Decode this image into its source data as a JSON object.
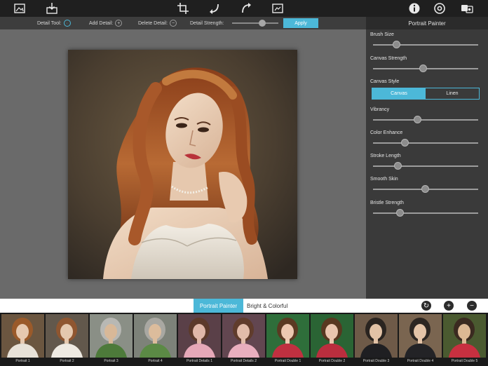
{
  "toolbar": {
    "left_icons": [
      "image-open-icon",
      "save-export-icon"
    ],
    "center_icons": [
      "crop-icon",
      "undo-icon",
      "redo-icon",
      "compare-icon"
    ],
    "right_icons": [
      "info-icon",
      "settings-icon",
      "share-icon"
    ]
  },
  "detail_bar": {
    "detail_tool_label": "Detail Tool:",
    "add_detail_label": "Add Detail:",
    "delete_detail_label": "Delete Detail:",
    "detail_strength_label": "Detail Strength:",
    "detail_strength_value": 0.65,
    "apply_label": "Apply"
  },
  "panel": {
    "title": "Portrait Painter",
    "sliders": [
      {
        "label": "Brush Size",
        "value": 0.22
      },
      {
        "label": "Canvas Strength",
        "value": 0.47
      },
      {
        "label": "Vibrancy",
        "value": 0.42
      },
      {
        "label": "Color Enhance",
        "value": 0.3
      },
      {
        "label": "Stroke Length",
        "value": 0.23
      },
      {
        "label": "Smooth Skin",
        "value": 0.49
      },
      {
        "label": "Bristle Strength",
        "value": 0.25
      }
    ],
    "canvas_style": {
      "label": "Canvas Style",
      "options": [
        "Canvas",
        "Linen"
      ],
      "selected": "Canvas"
    }
  },
  "preset_tabs": {
    "active": "Portrait Painter",
    "other": "Bright & Colorful"
  },
  "preset_icons": [
    "reset-icon",
    "add-icon",
    "remove-icon"
  ],
  "thumbnails": [
    {
      "label": "Portrait 1",
      "bg": "#6b5640",
      "hair": "#9a5a2a",
      "skin": "#e6c9b0",
      "dress": "#e8e2d8"
    },
    {
      "label": "Portrait 2",
      "bg": "#62584c",
      "hair": "#8f5630",
      "skin": "#e4c8ae",
      "dress": "#eeeae2"
    },
    {
      "label": "Portrait 3",
      "bg": "#8a8f86",
      "hair": "#b8b8b4",
      "skin": "#d8b898",
      "dress": "#4d7a3a"
    },
    {
      "label": "Portrait 4",
      "bg": "#7d8279",
      "hair": "#a9a8a2",
      "skin": "#dcbc9c",
      "dress": "#5b8a45"
    },
    {
      "label": "Portrait Details 1",
      "bg": "#5a4048",
      "hair": "#5c3a2a",
      "skin": "#e0b8a8",
      "dress": "#e6a8b8"
    },
    {
      "label": "Portrait Details 2",
      "bg": "#624650",
      "hair": "#603c2c",
      "skin": "#e2bcaa",
      "dress": "#e9aebe"
    },
    {
      "label": "Portrait Double 1",
      "bg": "#2e6e3a",
      "hair": "#5a3a22",
      "skin": "#ecc8b0",
      "dress": "#c03040"
    },
    {
      "label": "Portrait Double 2",
      "bg": "#2a6434",
      "hair": "#583820",
      "skin": "#eac6ae",
      "dress": "#bb2e3e"
    },
    {
      "label": "Portrait Double 3",
      "bg": "#6e5a48",
      "hair": "#2a2420",
      "skin": "#e2c2a6",
      "dress": "#1f1f22"
    },
    {
      "label": "Portrait Double 4",
      "bg": "#7a6550",
      "hair": "#2c2622",
      "skin": "#e4c4a8",
      "dress": "#232326"
    },
    {
      "label": "Portrait Double 5",
      "bg": "#4a5a30",
      "hair": "#3a2a20",
      "skin": "#dcb894",
      "dress": "#c83040"
    }
  ]
}
